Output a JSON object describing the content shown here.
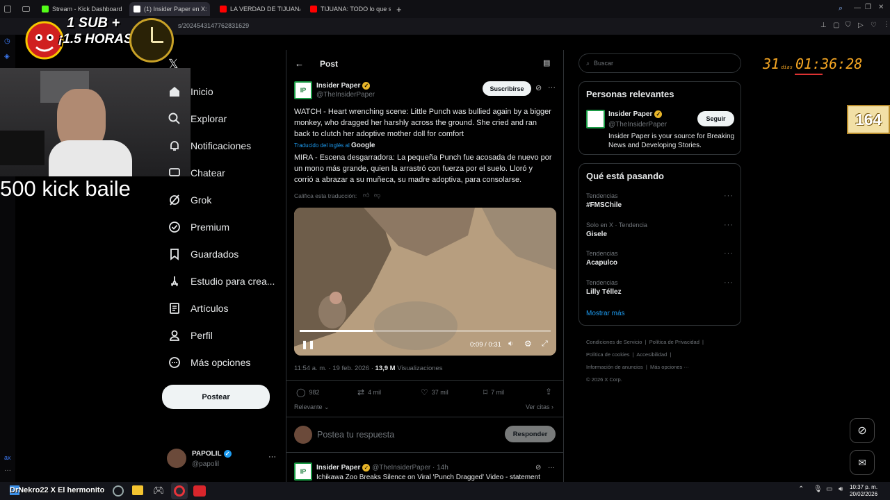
{
  "browser": {
    "tabs": [
      {
        "label": "Stream - Kick Dashboard",
        "color": "#53fc18"
      },
      {
        "label": "(1) Insider Paper en X:",
        "color": "#ffffff"
      },
      {
        "label": "LA VERDAD DE TIJUANA",
        "color": "#ff0000"
      },
      {
        "label": "TIJUANA: TODO lo que sa",
        "color": "#ff0000"
      }
    ],
    "new_tab": "+",
    "url": "s/2024543147762831629"
  },
  "overlay": {
    "badge_line1": "1 SUB +",
    "badge_line2": "¡1.5 HORAS!",
    "kick_text": "500 kick baile",
    "countdown_days": "31",
    "countdown_days_label": "días",
    "countdown_time": "01:36:28",
    "counter": "164"
  },
  "nav": {
    "items": [
      {
        "label": "Inicio",
        "icon": "home-icon"
      },
      {
        "label": "Explorar",
        "icon": "search-icon"
      },
      {
        "label": "Notificaciones",
        "icon": "bell-icon"
      },
      {
        "label": "Chatear",
        "icon": "chat-icon"
      },
      {
        "label": "Grok",
        "icon": "grok-icon"
      },
      {
        "label": "Premium",
        "icon": "premium-icon"
      },
      {
        "label": "Guardados",
        "icon": "bookmark-icon"
      },
      {
        "label": "Estudio para crea...",
        "icon": "studio-icon"
      },
      {
        "label": "Artículos",
        "icon": "articles-icon"
      },
      {
        "label": "Perfil",
        "icon": "profile-icon"
      },
      {
        "label": "Más opciones",
        "icon": "more-icon"
      }
    ],
    "post_button": "Postear",
    "user": {
      "name": "PAPOLIL",
      "handle": "@papolil"
    }
  },
  "post": {
    "header_title": "Post",
    "author_name": "Insider Paper",
    "author_handle": "@TheInsiderPaper",
    "subscribe_label": "Suscribirse",
    "text_en": "WATCH - Heart wrenching scene: Little Punch was bullied again by a bigger monkey, who dragged her harshly across the ground. She cried and ran back to clutch her adoptive mother doll for comfort",
    "translated_from": "Traducido del inglés al",
    "translator": "Google",
    "text_es": "MIRA - Escena desgarradora: La pequeña Punch fue acosada de nuevo por un mono más grande, quien la arrastró con fuerza por el suelo. Lloró y corrió a abrazar a su muñeca, su madre adoptiva, para consolarse.",
    "rate_translation": "Califica esta traducción:",
    "video": {
      "time": "0:09 / 0:31",
      "progress": 0.29
    },
    "timestamp": "11:54 a. m. · 19 feb. 2026 ·",
    "views_count": "13,9 M",
    "views_label": "Visualizaciones",
    "stats": {
      "replies": "982",
      "reposts": "4 mil",
      "likes": "37 mil",
      "bookmarks": "7 mil"
    },
    "sort_label": "Relevante",
    "quotes_label": "Ver citas",
    "reply_placeholder": "Postea tu respuesta",
    "reply_button": "Responder",
    "next_author": "Insider Paper",
    "next_handle": "@TheInsiderPaper · 14h",
    "next_text": "Ichikawa Zoo Breaks Silence on Viral 'Punch Dragged' Video - statement"
  },
  "right": {
    "search_placeholder": "Buscar",
    "relevant_title": "Personas relevantes",
    "relevant_name": "Insider Paper",
    "relevant_handle": "@TheInsiderPaper",
    "relevant_bio": "Insider Paper is your source for Breaking News and Developing Stories.",
    "follow_label": "Seguir",
    "trends_title": "Qué está pasando",
    "trends": [
      {
        "category": "Tendencias",
        "name": "#FMSChile"
      },
      {
        "category": "Solo en X · Tendencia",
        "name": "Gisele"
      },
      {
        "category": "Tendencias",
        "name": "Acapulco"
      },
      {
        "category": "Tendencias",
        "name": "Lilly Téllez"
      }
    ],
    "show_more": "Mostrar más",
    "footer": {
      "terms": "Condiciones de Servicio",
      "privacy": "Política de Privacidad",
      "cookies": "Política de cookies",
      "accessibility": "Accesibilidad",
      "ads": "Información de anuncios",
      "more": "Más opciones ···",
      "copyright": "© 2026 X Corp."
    }
  },
  "taskbar": {
    "ticker": "DrNekro22 X El hermonito",
    "time": "10:37 p. m.",
    "date": "20/02/2026"
  }
}
